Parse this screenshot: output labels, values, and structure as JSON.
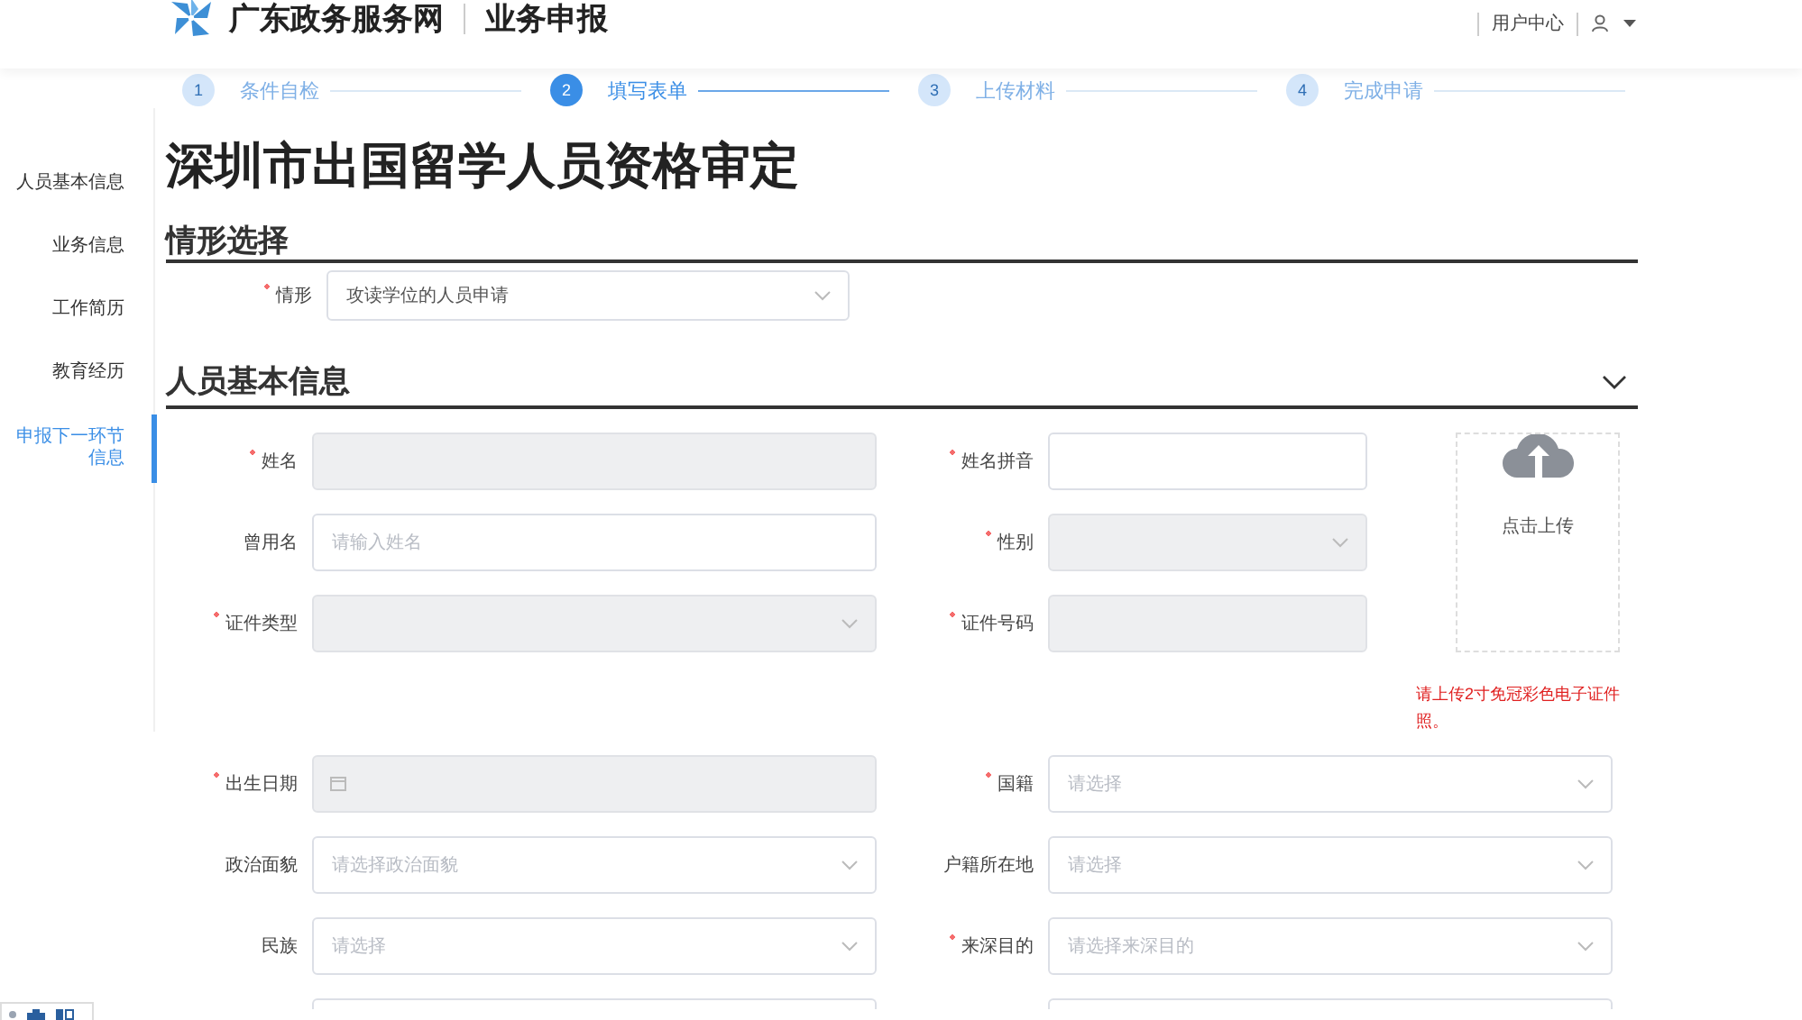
{
  "header": {
    "site_name": "广东政务服务网",
    "section": "业务申报",
    "user_center": "用户中心"
  },
  "steps": [
    {
      "number": "1",
      "label": "条件自检",
      "selected": false
    },
    {
      "number": "2",
      "label": "填写表单",
      "selected": true
    },
    {
      "number": "3",
      "label": "上传材料",
      "selected": false
    },
    {
      "number": "4",
      "label": "完成申请",
      "selected": false
    }
  ],
  "title": "深圳市出国留学人员资格审定",
  "sidebar": {
    "items": [
      {
        "label": "人员基本信息",
        "selected": false
      },
      {
        "label": "业务信息",
        "selected": false
      },
      {
        "label": "工作简历",
        "selected": false
      },
      {
        "label": "教育经历",
        "selected": false
      },
      {
        "label": "申报下一环节信息",
        "selected": true
      }
    ]
  },
  "situation": {
    "title": "情形选择",
    "field": {
      "label": "情形",
      "required": true,
      "kind": "select",
      "value": "攻读学位的人员申请",
      "disabled": false
    }
  },
  "basic_info": {
    "title": "人员基本信息",
    "expanded": true,
    "upload": {
      "label": "点击上传",
      "hint": "请上传2寸免冠彩色电子证件照。"
    },
    "rows": [
      [
        {
          "label": "姓名",
          "required": true,
          "kind": "text",
          "disabled": true
        },
        {
          "label": "姓名拼音",
          "required": true,
          "kind": "text",
          "disabled": false
        }
      ],
      [
        {
          "label": "曾用名",
          "required": false,
          "kind": "text",
          "placeholder": "请输入姓名",
          "disabled": false
        },
        {
          "label": "性别",
          "required": true,
          "kind": "select",
          "disabled": true
        }
      ],
      [
        {
          "label": "证件类型",
          "required": true,
          "kind": "select",
          "disabled": true
        },
        {
          "label": "证件号码",
          "required": true,
          "kind": "text",
          "disabled": true
        }
      ],
      [
        {
          "label": "出生日期",
          "required": true,
          "kind": "date",
          "disabled": true
        },
        {
          "label": "国籍",
          "required": true,
          "kind": "select",
          "placeholder": "请选择",
          "disabled": false
        }
      ],
      [
        {
          "label": "政治面貌",
          "required": false,
          "kind": "select",
          "placeholder": "请选择政治面貌",
          "disabled": false
        },
        {
          "label": "户籍所在地",
          "required": false,
          "kind": "select",
          "placeholder": "请选择",
          "disabled": false
        }
      ],
      [
        {
          "label": "民族",
          "required": false,
          "kind": "select",
          "placeholder": "请选择",
          "disabled": false
        },
        {
          "label": "来深目的",
          "required": true,
          "kind": "select",
          "placeholder": "请选择来深目的",
          "disabled": false
        }
      ],
      [
        {
          "kind": "text",
          "disabled": false
        },
        {
          "kind": "text",
          "disabled": false
        }
      ]
    ]
  }
}
